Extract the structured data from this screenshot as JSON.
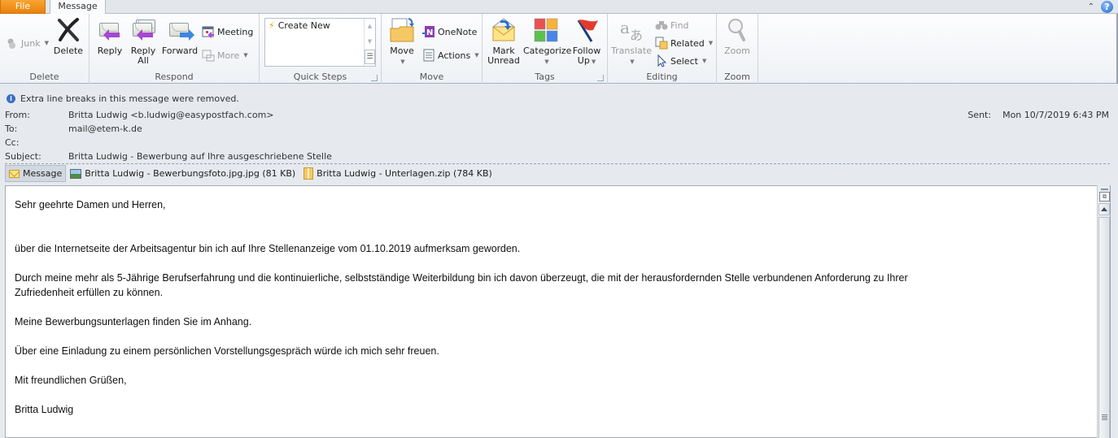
{
  "tabs": {
    "file": "File",
    "message": "Message"
  },
  "window": {
    "collapse_ribbon_icon": "chevron-up-icon",
    "help_icon": "help-icon",
    "help_glyph": "?"
  },
  "ribbon": {
    "groups": {
      "delete": {
        "label": "Delete",
        "junk": "Junk",
        "delete": "Delete"
      },
      "respond": {
        "label": "Respond",
        "reply": "Reply",
        "reply_all_1": "Reply",
        "reply_all_2": "All",
        "forward": "Forward",
        "meeting": "Meeting",
        "more": "More"
      },
      "quick_steps": {
        "label": "Quick Steps",
        "create_new": "Create New"
      },
      "move": {
        "label": "Move",
        "move": "Move",
        "onenote": "OneNote",
        "actions": "Actions"
      },
      "tags": {
        "label": "Tags",
        "mark_unread_1": "Mark",
        "mark_unread_2": "Unread",
        "categorize": "Categorize",
        "follow_up_1": "Follow",
        "follow_up_2": "Up"
      },
      "editing": {
        "label": "Editing",
        "translate": "Translate",
        "find": "Find",
        "related": "Related",
        "select": "Select"
      },
      "zoom": {
        "label": "Zoom",
        "zoom": "Zoom"
      }
    },
    "category_colors": [
      "#e8514f",
      "#f7b23b",
      "#5ac24c",
      "#4a86e8"
    ]
  },
  "info_bar": "Extra line breaks in this message were removed.",
  "header": {
    "from_label": "From:",
    "from_value": "Britta Ludwig <b.ludwig@easypostfach.com>",
    "to_label": "To:",
    "to_value": "mail@etem-k.de",
    "cc_label": "Cc:",
    "cc_value": "",
    "subject_label": "Subject:",
    "subject_value": "Britta Ludwig - Bewerbung auf Ihre ausgeschriebene Stelle",
    "sent_label": "Sent:",
    "sent_value": "Mon 10/7/2019 6:43 PM"
  },
  "attachments": [
    {
      "label": "Message",
      "icon": "envelope-icon",
      "selected": true
    },
    {
      "label": "Britta Ludwig - Bewerbungsfoto.jpg.jpg (81 KB)",
      "icon": "image-file-icon"
    },
    {
      "label": "Britta Ludwig - Unterlagen.zip (784 KB)",
      "icon": "zip-file-icon"
    }
  ],
  "body": {
    "greeting": "Sehr geehrte Damen und Herren,",
    "p1": "über die Internetseite der Arbeitsagentur bin ich auf Ihre Stellenanzeige vom 01.10.2019 aufmerksam geworden.",
    "p2a": "Durch meine mehr als 5-Jährige Berufserfahrung und die kontinuierliche, selbstständige Weiterbildung bin ich davon überzeugt, die mit der herausfordernden Stelle verbundenen Anforderung zu Ihrer",
    "p2b": "Zufriedenheit erfüllen zu können.",
    "p3": "Meine Bewerbungsunterlagen finden Sie im Anhang.",
    "p4": "Über eine Einladung zu einem persönlichen Vorstellungsgespräch würde ich mich sehr freuen.",
    "closing": "Mit freundlichen Grüßen,",
    "signature": "Britta Ludwig"
  }
}
